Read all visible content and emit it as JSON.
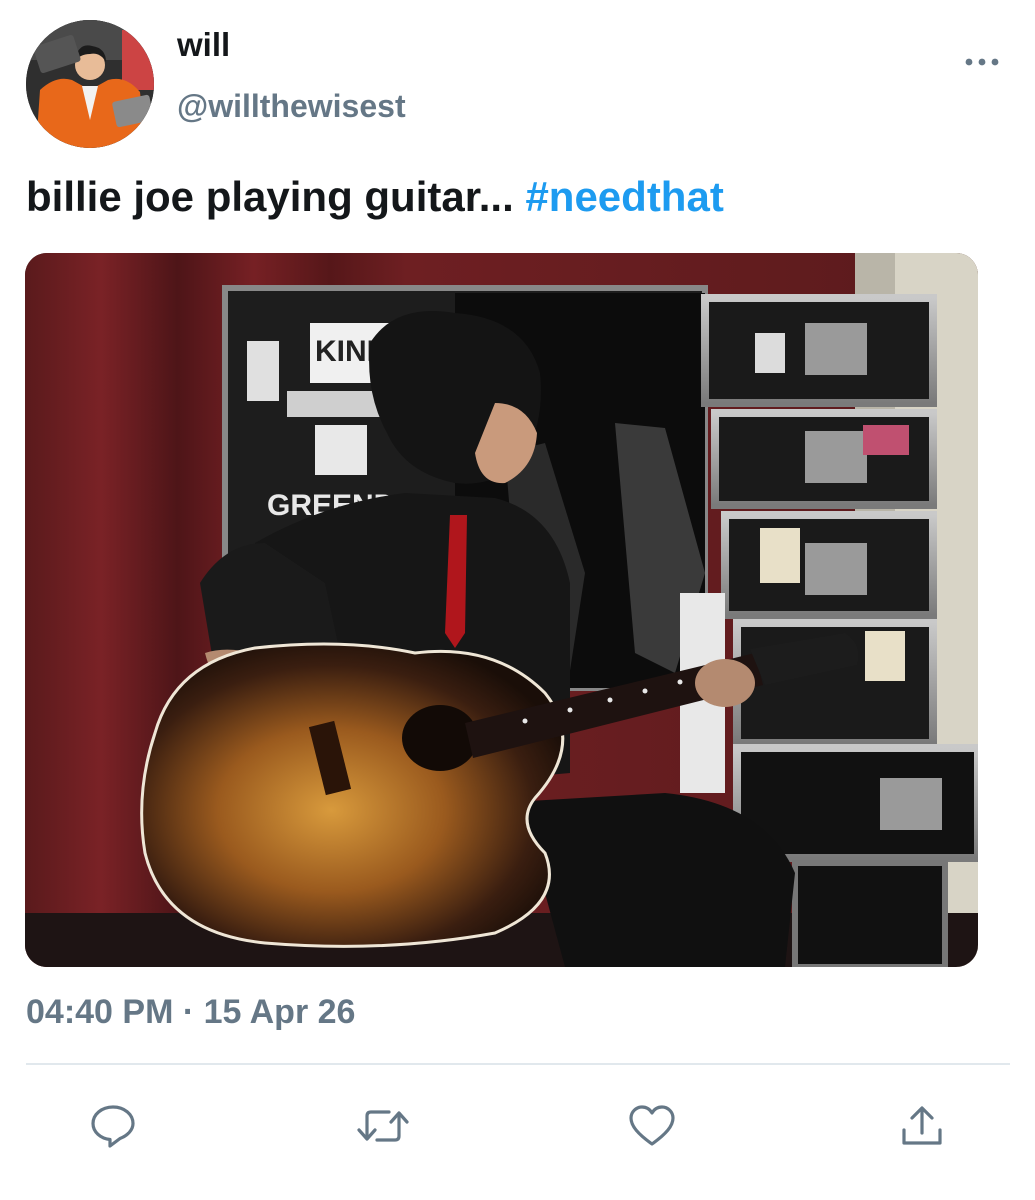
{
  "tweet": {
    "author": {
      "display_name": "will",
      "handle": "@willthewisest"
    },
    "text": "billie joe playing guitar... ",
    "hashtag": "#needthat",
    "timestamp": "04:40 PM · 15 Apr 26"
  },
  "icons": {
    "more": "more-dots-icon",
    "reply": "reply-icon",
    "retweet": "retweet-icon",
    "like": "heart-icon",
    "share": "share-icon"
  },
  "colors": {
    "text": "#14171a",
    "secondary": "#657786",
    "hashtag": "#1d9bf0",
    "divider": "#e1e8ed"
  }
}
